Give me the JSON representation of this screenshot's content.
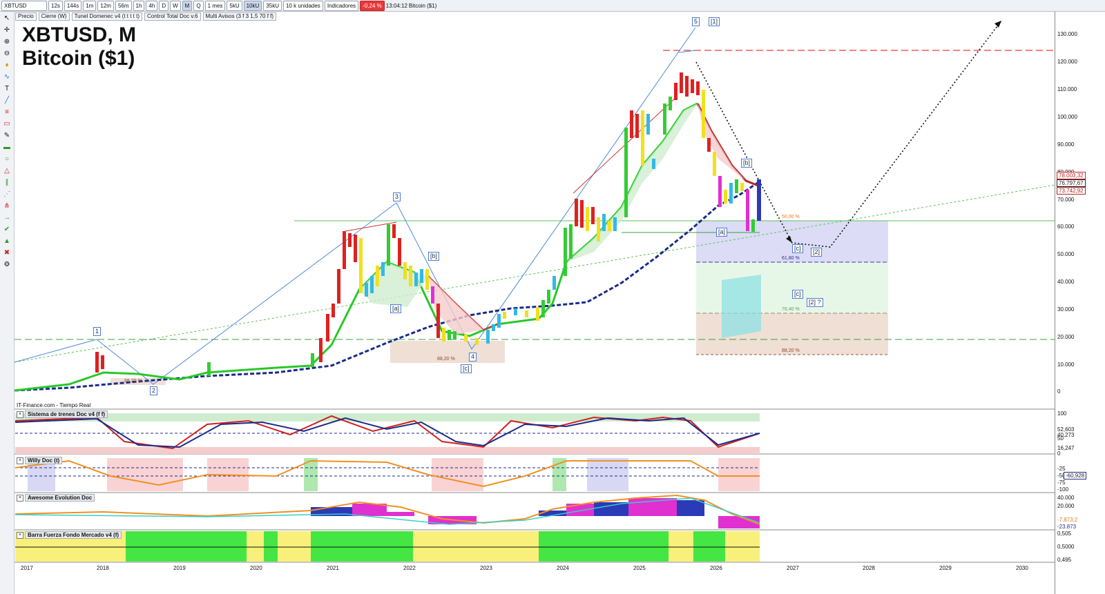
{
  "toolbar": {
    "symbol": "XBTUSD",
    "timeframes": [
      "12s",
      "144s",
      "1m",
      "12m",
      "56m",
      "1h",
      "4h",
      "D",
      "W",
      "M",
      "Q"
    ],
    "active_timeframe": "M",
    "period": "1 mes",
    "units": [
      "5kU",
      "10kU",
      "35kU"
    ],
    "active_unit": "10kU",
    "unit_dropdown": "10 k unidades",
    "indicators_label": "Indicadores",
    "change": "-0,24 %",
    "time": "13:04:12",
    "instrument_name": "Bitcoin ($1)"
  },
  "legend": [
    "Precio",
    "Cierre (W)",
    "Tunel Domenec v4 (t t t t t)",
    "Control Total Doc v.6",
    "Multi Avisos (3 f 3 1,5 70 f f)"
  ],
  "chart_title": {
    "line1": "XBTUSD, M",
    "line2": "Bitcoin ($1)"
  },
  "credit": "IT-Finance.com - Tiempo Real",
  "colors": {
    "up_green": "#33cc33",
    "down_red": "#e02020",
    "yellow": "#f0e01e",
    "cyan": "#33b8e8",
    "magenta": "#e030d0",
    "navy_dash": "#1a2a8a",
    "red_dash": "#e83a3a"
  },
  "price_axis": {
    "ticks": [
      "130.000",
      "120.000",
      "110.000",
      "100.000",
      "90.000",
      "80.000",
      "70.000",
      "60.000",
      "50.000",
      "40.000",
      "30.000",
      "20.000",
      "10.000",
      "0"
    ],
    "boxes": [
      {
        "text": "78.003,32",
        "color": "#cc2020"
      },
      {
        "text": "76.797,67",
        "color": "#222222"
      },
      {
        "text": "73.742,92",
        "color": "#b02020"
      }
    ]
  },
  "time_axis": [
    "2017",
    "2018",
    "2019",
    "2020",
    "2021",
    "2022",
    "2023",
    "2024",
    "2025",
    "2026",
    "2027",
    "2028",
    "2029",
    "2030"
  ],
  "wave_labels": [
    "1",
    "2",
    "3",
    "4",
    "5",
    "[1]",
    "[a]",
    "[b]",
    "[c]",
    "[a]",
    "[b]",
    "[c]",
    "[c]",
    "[2]",
    "[2] ?"
  ],
  "fib_labels": [
    "88,20 %",
    "88,20 %",
    "50,00 %",
    "61,80 %",
    "76,40 %",
    "88,20 %"
  ],
  "panels": [
    {
      "title": "Sistema de trenes Doc v4 (f f)",
      "ticks": [
        "100",
        "52,603",
        "40,273",
        "50",
        "16,247",
        "0"
      ]
    },
    {
      "title": "Willy Doc (t)",
      "ticks": [
        "-25",
        "-50",
        "-75",
        "-100"
      ],
      "box": "-60,928"
    },
    {
      "title": "Awesome Evolution Doc",
      "ticks": [
        "40.000",
        "20.000",
        "-7.873,2",
        "-23.873"
      ]
    },
    {
      "title": "Barra Fuerza Fondo Mercado v4 (f)",
      "ticks": [
        "0,505",
        "0,5000",
        "0,495"
      ]
    }
  ],
  "sidebar_icons": [
    "cursor-icon",
    "crosshair-icon",
    "zoom-in-icon",
    "zoom-out-icon",
    "bell-icon",
    "wave-icon",
    "text-icon",
    "trendline-icon",
    "fib-icon",
    "rectangle-icon",
    "pen-icon",
    "ruler-icon",
    "circle-icon",
    "triangle-icon",
    "channel-icon",
    "gann-icon",
    "pitchfork-icon",
    "arrow-icon",
    "check-icon",
    "thumbs-icon",
    "delete-icon",
    "settings-icon"
  ]
}
